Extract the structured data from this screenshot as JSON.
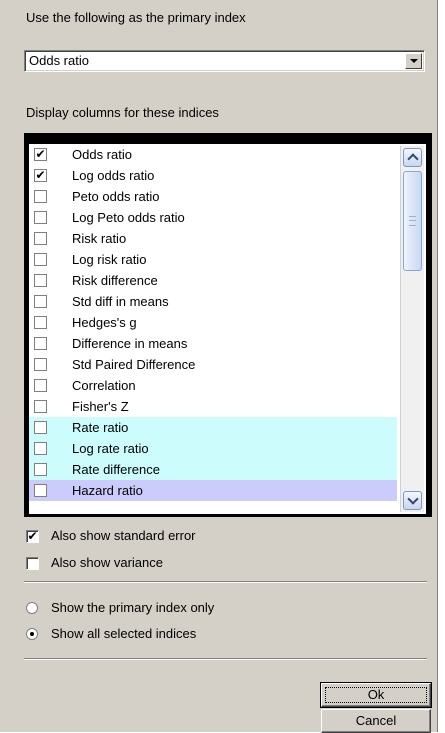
{
  "primary_index": {
    "label": "Use the following as the primary index",
    "selected": "Odds ratio"
  },
  "display_columns": {
    "label": "Display columns for these indices",
    "items": [
      {
        "label": "Odds ratio",
        "checked": true,
        "highlight": ""
      },
      {
        "label": "Log odds ratio",
        "checked": true,
        "highlight": ""
      },
      {
        "label": "Peto odds ratio",
        "checked": false,
        "highlight": ""
      },
      {
        "label": "Log Peto odds ratio",
        "checked": false,
        "highlight": ""
      },
      {
        "label": "Risk ratio",
        "checked": false,
        "highlight": ""
      },
      {
        "label": "Log risk ratio",
        "checked": false,
        "highlight": ""
      },
      {
        "label": "Risk difference",
        "checked": false,
        "highlight": ""
      },
      {
        "label": "Std diff in means",
        "checked": false,
        "highlight": ""
      },
      {
        "label": "Hedges's g",
        "checked": false,
        "highlight": ""
      },
      {
        "label": "Difference in means",
        "checked": false,
        "highlight": ""
      },
      {
        "label": "Std Paired Difference",
        "checked": false,
        "highlight": ""
      },
      {
        "label": "Correlation",
        "checked": false,
        "highlight": ""
      },
      {
        "label": "Fisher's Z",
        "checked": false,
        "highlight": ""
      },
      {
        "label": "Rate ratio",
        "checked": false,
        "highlight": "#ccfcfc"
      },
      {
        "label": "Log rate ratio",
        "checked": false,
        "highlight": "#ccfcfc"
      },
      {
        "label": "Rate difference",
        "checked": false,
        "highlight": "#ccfcfc"
      },
      {
        "label": "Hazard ratio",
        "checked": false,
        "highlight": "#ccccfc"
      }
    ]
  },
  "options": {
    "standard_error": {
      "label": "Also show standard error",
      "checked": true
    },
    "variance": {
      "label": "Also show variance",
      "checked": false
    }
  },
  "mode": {
    "primary_only": {
      "label": "Show the primary index only",
      "selected": false
    },
    "all_selected": {
      "label": "Show all selected indices",
      "selected": true
    }
  },
  "buttons": {
    "ok": "Ok",
    "cancel": "Cancel"
  },
  "check_glyph": "✔"
}
